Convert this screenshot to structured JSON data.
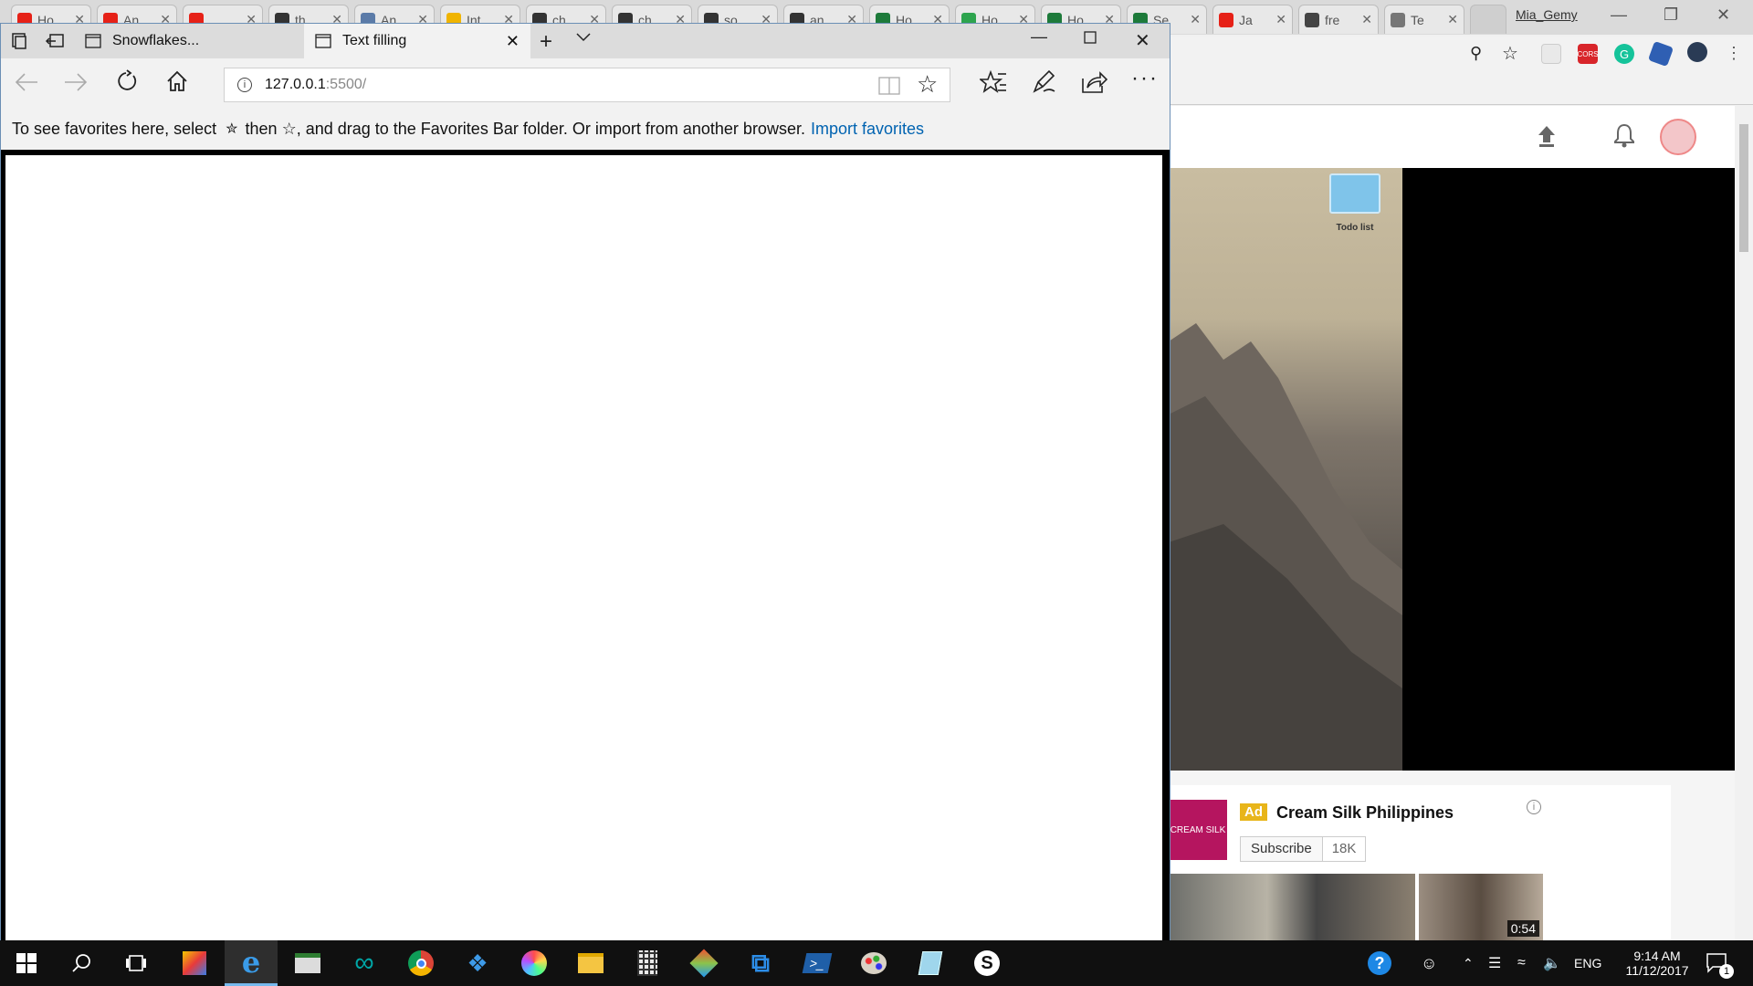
{
  "chrome": {
    "tabs": [
      {
        "label": "Ho",
        "icon": "youtube-icon",
        "color": "#e62117"
      },
      {
        "label": "An",
        "icon": "youtube-icon",
        "color": "#e62117"
      },
      {
        "label": "",
        "icon": "youtube-audio-icon",
        "color": "#e62117"
      },
      {
        "label": "th",
        "icon": "github-icon",
        "color": "#333333"
      },
      {
        "label": "An",
        "icon": "site-icon",
        "color": "#5b7ba8"
      },
      {
        "label": "Int",
        "icon": "site-icon",
        "color": "#f0b400"
      },
      {
        "label": "ch",
        "icon": "github-icon",
        "color": "#333333"
      },
      {
        "label": "ch",
        "icon": "github-icon",
        "color": "#333333"
      },
      {
        "label": "so",
        "icon": "github-icon",
        "color": "#333333"
      },
      {
        "label": "an",
        "icon": "github-icon",
        "color": "#333333"
      },
      {
        "label": "Ho",
        "icon": "sheet-icon",
        "color": "#1d7a3a"
      },
      {
        "label": "Ho",
        "icon": "site-icon",
        "color": "#2da44e"
      },
      {
        "label": "Ho",
        "icon": "sheet-icon",
        "color": "#1d7a3a"
      },
      {
        "label": "Se",
        "icon": "sheet-icon",
        "color": "#1d7a3a"
      },
      {
        "label": "Ja",
        "icon": "youtube-icon",
        "color": "#e62117"
      },
      {
        "label": "fre",
        "icon": "hash-icon",
        "color": "#444444"
      },
      {
        "label": "Te",
        "icon": "page-icon",
        "color": "#777777"
      }
    ],
    "user": "Mia_Gemy",
    "youtube": {
      "ad_badge": "Ad",
      "channel": "Cream Silk Philippines",
      "channel_logo": "CREAM SILK",
      "subscribe": "Subscribe",
      "subscribers": "18K",
      "video_duration": "0:54",
      "desktop_folder": "Todo list"
    }
  },
  "edge": {
    "tabs": [
      {
        "label": "Snowflakes..."
      },
      {
        "label": "Text filling"
      }
    ],
    "address": {
      "host": "127.0.0.1",
      "port": ":5500/"
    },
    "favorites_bar": {
      "text_before": "To see favorites here, select",
      "text_middle": "then ☆, and drag to the Favorites Bar folder. Or import from another browser.",
      "link": "Import favorites"
    }
  },
  "taskbar": {
    "apps": [
      "start-icon",
      "search-icon",
      "task-view-icon",
      "photo-app-icon",
      "edge-icon",
      "screen-sketch-icon",
      "arduino-icon",
      "chrome-icon",
      "dropbox-icon",
      "color-picker-icon",
      "file-explorer-icon",
      "calculator-icon",
      "git-icon",
      "vscode-icon",
      "powershell-icon",
      "paint-icon",
      "notepad-icon",
      "skype-icon"
    ],
    "lang": "ENG",
    "time": "9:14 AM",
    "date": "11/12/2017",
    "notifications": "1"
  }
}
